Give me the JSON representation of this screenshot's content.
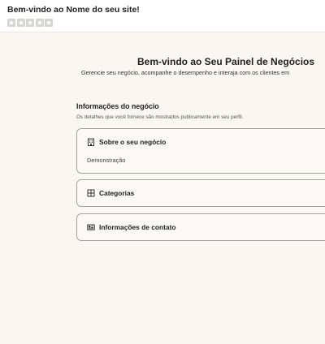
{
  "header": {
    "site_title": "Bem-vindo ao Nome do seu site!",
    "rating": {
      "value": 0,
      "max": 5
    }
  },
  "main": {
    "title": "Bem-vindo ao Seu Painel de Negócios",
    "subtitle": "Gerencie seu negócio, acompanhe o desempenho e interaja com os clientes em",
    "section": {
      "title": "Informações do negócio",
      "description": "Os detalhes que você fornece são mostrados publicamente em seu perfil."
    },
    "cards": {
      "about": {
        "label": "Sobre o seu negócio",
        "value": "Demonstração",
        "icon": "building-icon"
      },
      "categories": {
        "label": "Categorias",
        "icon": "grid-icon"
      },
      "contact": {
        "label": "Informações de contato",
        "icon": "contact-card-icon"
      }
    }
  },
  "colors": {
    "background": "#faf7f2",
    "card_border": "#a9a39a",
    "star_empty": "#d8d5d0"
  }
}
